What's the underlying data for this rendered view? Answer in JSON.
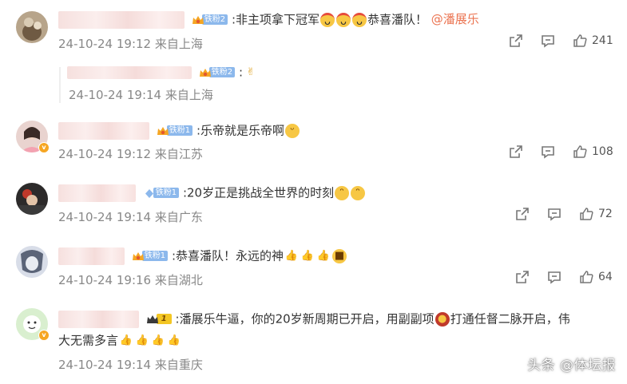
{
  "comments": [
    {
      "fan_badge": "铁粉2",
      "text": ":非主项拿下冠军",
      "text_after": "恭喜潘队！",
      "mention": "@潘展乐",
      "time": "24-10-24 19:12",
      "location": "来自上海",
      "likes": "241",
      "reply": {
        "fan_badge": "铁粉2",
        "text": ":",
        "time": "24-10-24 19:14",
        "location": "来自上海"
      }
    },
    {
      "fan_badge": "铁粉1",
      "text": ":乐帝就是乐帝啊",
      "time": "24-10-24 19:12",
      "location": "来自江苏",
      "likes": "108"
    },
    {
      "fan_badge": "铁粉1",
      "text": ":20岁正是挑战全世界的时刻",
      "time": "24-10-24 19:14",
      "location": "来自广东",
      "likes": "72"
    },
    {
      "fan_badge": "铁粉1",
      "text": ":恭喜潘队！永远的神",
      "time": "24-10-24 19:16",
      "location": "来自湖北",
      "likes": "64"
    },
    {
      "fan_badge": "1",
      "text": ":潘展乐牛逼，你的20岁新周期已开启，用副副项",
      "text_after": "打通任督二脉开启，伟",
      "text_line2": "大无需多言",
      "time": "24-10-24 19:14",
      "location": "来自重庆"
    }
  ],
  "watermark": "头条 @体坛报",
  "colors": {
    "mention": "#eb7350",
    "meta": "#888888",
    "badge": "#8cb8ec",
    "verified": "#f6a623"
  }
}
